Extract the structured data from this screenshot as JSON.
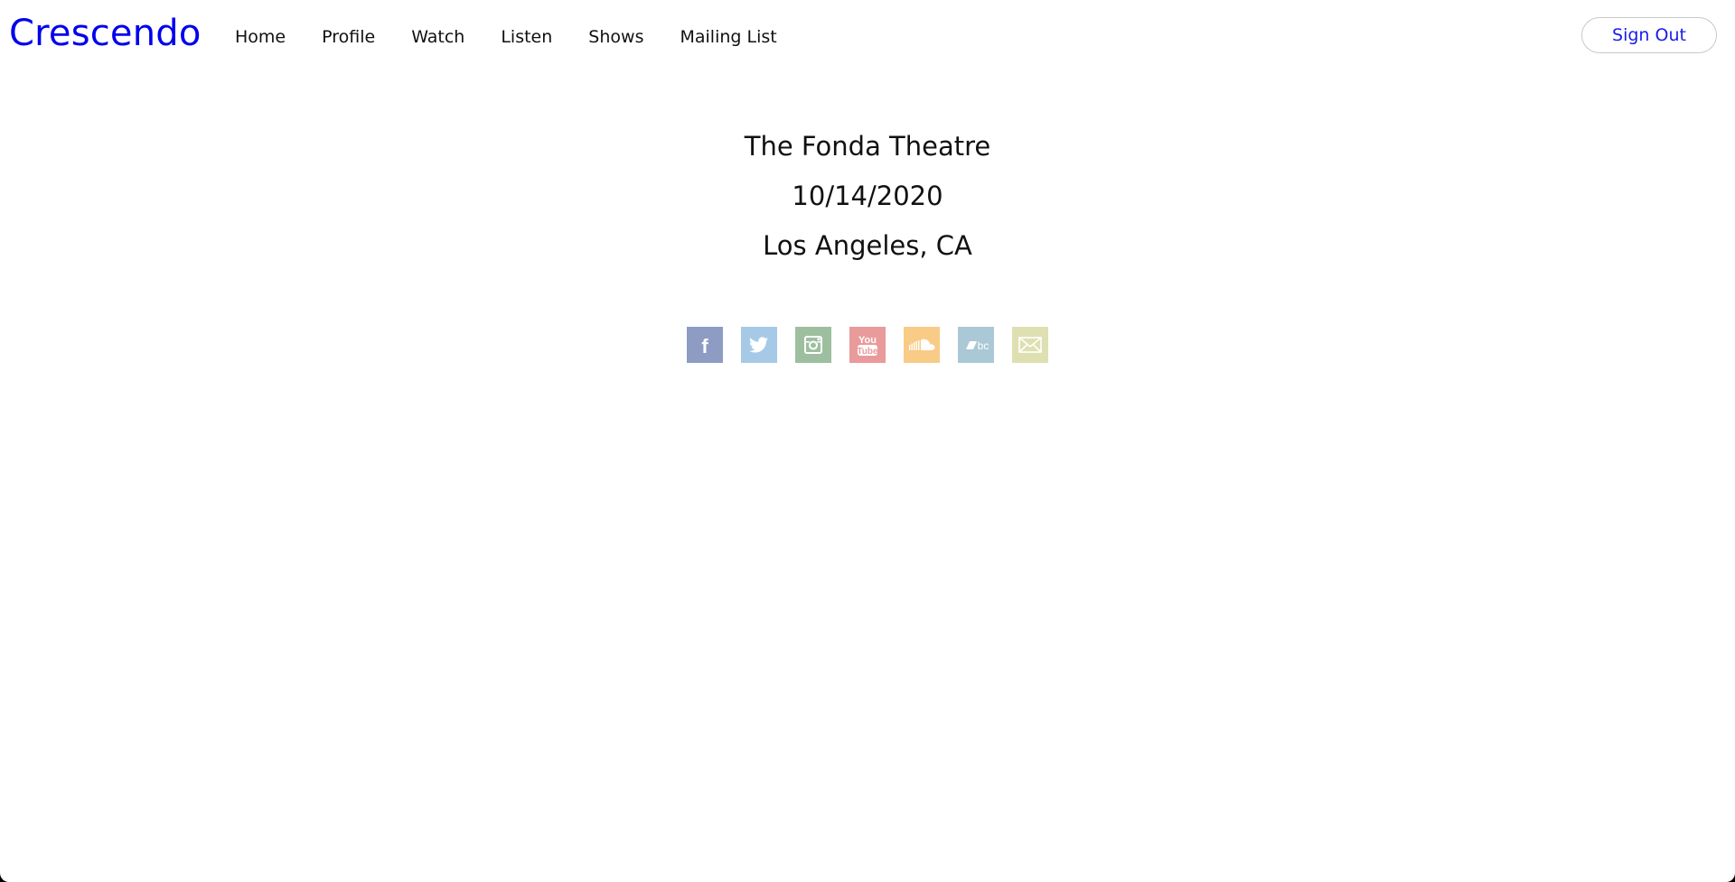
{
  "navbar": {
    "brand": "Crescendo",
    "links": [
      {
        "label": "Home"
      },
      {
        "label": "Profile"
      },
      {
        "label": "Watch"
      },
      {
        "label": "Listen"
      },
      {
        "label": "Shows"
      },
      {
        "label": "Mailing List"
      }
    ],
    "sign_out_label": "Sign Out"
  },
  "show": {
    "venue": "The Fonda Theatre",
    "date": "10/14/2020",
    "location": "Los Angeles, CA"
  },
  "social": {
    "icons": [
      {
        "name": "facebook-icon",
        "color": "#8e9cc3",
        "glyph": "f"
      },
      {
        "name": "twitter-icon",
        "color": "#a7c9e8"
      },
      {
        "name": "instagram-icon",
        "color": "#9dbf9f"
      },
      {
        "name": "youtube-icon",
        "color": "#e99a9b",
        "glyph_top": "You",
        "glyph_bottom": "Tube"
      },
      {
        "name": "soundcloud-icon",
        "color": "#f8cb86"
      },
      {
        "name": "bandcamp-icon",
        "color": "#aac8d5",
        "glyph": "bc"
      },
      {
        "name": "email-icon",
        "color": "#dfe0b1"
      }
    ]
  },
  "colors": {
    "brand": "#0000ee",
    "sign_out_text": "#1a1aee",
    "background": "#ffffff"
  }
}
